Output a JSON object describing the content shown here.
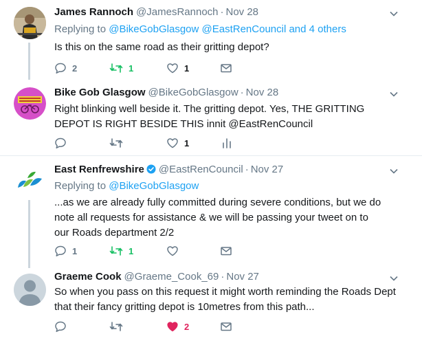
{
  "colors": {
    "text": "#14171a",
    "muted": "#657786",
    "link": "#1da1f2",
    "retweet": "#17bf63",
    "like": "#e0245e",
    "thread_line": "#ccd6dd"
  },
  "tweets": [
    {
      "name": "James Rannoch",
      "handle": "@JamesRannoch",
      "dot": "·",
      "time": "Nov 28",
      "replying_prefix": "Replying to ",
      "replying_targets": "@BikeGobGlasgow @EastRenCouncil",
      "replying_suffix": " and 4 others",
      "text": "Is this on the same road as their gritting depot?",
      "reply_count": "2",
      "retweet_count": "1",
      "like_count": "1"
    },
    {
      "name": "Bike Gob Glasgow",
      "handle": "@BikeGobGlasgow",
      "dot": "·",
      "time": "Nov 28",
      "text": "Right blinking well beside it. The gritting depot. Yes, THE GRITTING DEPOT IS RIGHT BESIDE THIS innit @EastRenCouncil",
      "like_count": "1"
    },
    {
      "name": "East Renfrewshire",
      "handle": "@EastRenCouncil",
      "dot": "·",
      "time": "Nov 27",
      "replying_prefix": "Replying to ",
      "replying_targets": "@BikeGobGlasgow",
      "text": "...as we are already fully committed during severe conditions, but we do note all requests for assistance & we will be passing your tweet on to our Roads department 2/2",
      "reply_count": "1",
      "retweet_count": "1"
    },
    {
      "name": "Graeme Cook",
      "handle": "@Graeme_Cook_69",
      "dot": "·",
      "time": "Nov 27",
      "text": "So when you pass on this request it might worth reminding the Roads Dept that their fancy gritting depot is 10metres from this path...",
      "like_count": "2"
    }
  ]
}
